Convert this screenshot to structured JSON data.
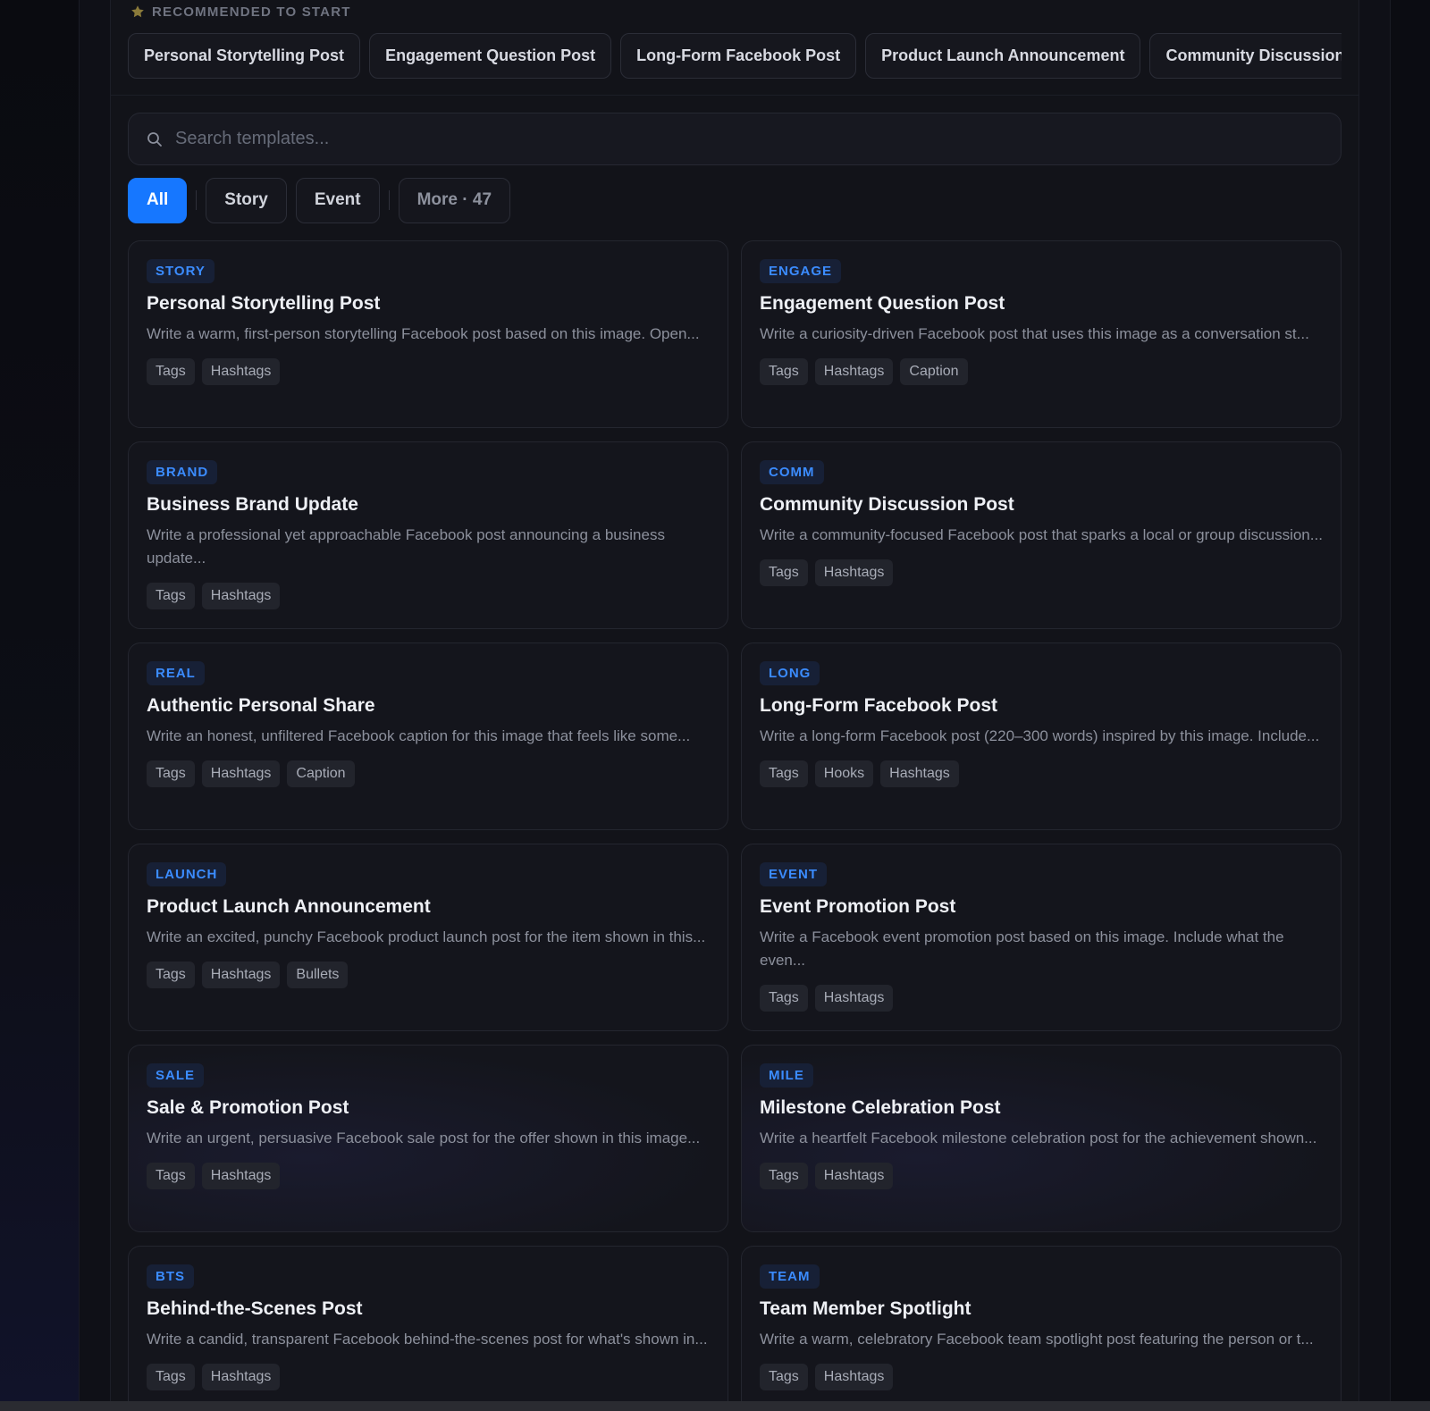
{
  "recommended": {
    "title": "RECOMMENDED TO START",
    "items": [
      "Personal Storytelling Post",
      "Engagement Question Post",
      "Long-Form Facebook Post",
      "Product Launch Announcement",
      "Community Discussion Post"
    ]
  },
  "search": {
    "placeholder": "Search templates..."
  },
  "filters": {
    "all": "All",
    "story": "Story",
    "event": "Event",
    "more": "More · 47"
  },
  "templates": [
    {
      "badge": "STORY",
      "title": "Personal Storytelling Post",
      "desc": "Write a warm, first-person storytelling Facebook post based on this image. Open...",
      "tags": [
        "Tags",
        "Hashtags"
      ]
    },
    {
      "badge": "ENGAGE",
      "title": "Engagement Question Post",
      "desc": "Write a curiosity-driven Facebook post that uses this image as a conversation st...",
      "tags": [
        "Tags",
        "Hashtags",
        "Caption"
      ]
    },
    {
      "badge": "BRAND",
      "title": "Business Brand Update",
      "desc": "Write a professional yet approachable Facebook post announcing a business update...",
      "tags": [
        "Tags",
        "Hashtags"
      ]
    },
    {
      "badge": "COMM",
      "title": "Community Discussion Post",
      "desc": "Write a community-focused Facebook post that sparks a local or group discussion...",
      "tags": [
        "Tags",
        "Hashtags"
      ]
    },
    {
      "badge": "REAL",
      "title": "Authentic Personal Share",
      "desc": "Write an honest, unfiltered Facebook caption for this image that feels like some...",
      "tags": [
        "Tags",
        "Hashtags",
        "Caption"
      ]
    },
    {
      "badge": "LONG",
      "title": "Long-Form Facebook Post",
      "desc": "Write a long-form Facebook post (220–300 words) inspired by this image. Include...",
      "tags": [
        "Tags",
        "Hooks",
        "Hashtags"
      ]
    },
    {
      "badge": "LAUNCH",
      "title": "Product Launch Announcement",
      "desc": "Write an excited, punchy Facebook product launch post for the item shown in this...",
      "tags": [
        "Tags",
        "Hashtags",
        "Bullets"
      ]
    },
    {
      "badge": "EVENT",
      "title": "Event Promotion Post",
      "desc": "Write a Facebook event promotion post based on this image. Include what the even...",
      "tags": [
        "Tags",
        "Hashtags"
      ]
    },
    {
      "badge": "SALE",
      "title": "Sale & Promotion Post",
      "desc": "Write an urgent, persuasive Facebook sale post for the offer shown in this image...",
      "tags": [
        "Tags",
        "Hashtags"
      ]
    },
    {
      "badge": "MILE",
      "title": "Milestone Celebration Post",
      "desc": "Write a heartfelt Facebook milestone celebration post for the achievement shown...",
      "tags": [
        "Tags",
        "Hashtags"
      ]
    },
    {
      "badge": "BTS",
      "title": "Behind-the-Scenes Post",
      "desc": "Write a candid, transparent Facebook behind-the-scenes post for what's shown in...",
      "tags": [
        "Tags",
        "Hashtags"
      ]
    },
    {
      "badge": "TEAM",
      "title": "Team Member Spotlight",
      "desc": "Write a warm, celebratory Facebook team spotlight post featuring the person or t...",
      "tags": [
        "Tags",
        "Hashtags"
      ]
    }
  ],
  "colors": {
    "accent": "#1677ff",
    "badge_text": "#3b8cff",
    "background": "#0b0c12"
  },
  "icons": {
    "recommended": "star-icon",
    "search": "search-icon"
  }
}
